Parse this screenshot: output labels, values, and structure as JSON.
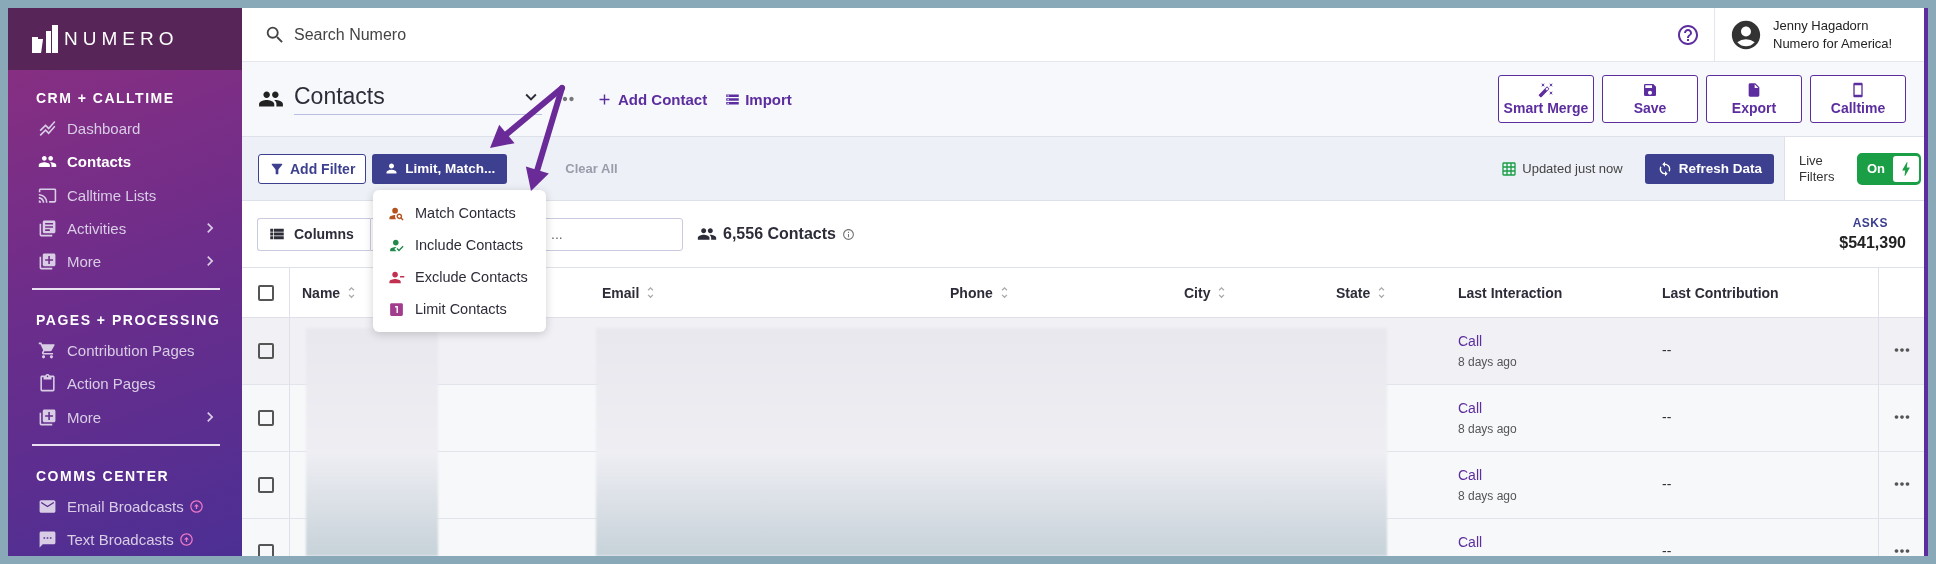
{
  "brand": {
    "name": "NUMERO"
  },
  "sidebar": {
    "sections": [
      {
        "title": "CRM + CALLTIME",
        "items": [
          {
            "label": "Dashboard",
            "selected": false,
            "has_submenu": false,
            "upgrade": false
          },
          {
            "label": "Contacts",
            "selected": true,
            "has_submenu": false,
            "upgrade": false
          },
          {
            "label": "Calltime Lists",
            "selected": false,
            "has_submenu": false,
            "upgrade": false
          },
          {
            "label": "Activities",
            "selected": false,
            "has_submenu": true,
            "upgrade": false
          },
          {
            "label": "More",
            "selected": false,
            "has_submenu": true,
            "upgrade": false
          }
        ]
      },
      {
        "title": "PAGES + PROCESSING",
        "items": [
          {
            "label": "Contribution Pages",
            "selected": false,
            "has_submenu": false,
            "upgrade": false
          },
          {
            "label": "Action Pages",
            "selected": false,
            "has_submenu": false,
            "upgrade": false
          },
          {
            "label": "More",
            "selected": false,
            "has_submenu": true,
            "upgrade": false
          }
        ]
      },
      {
        "title": "COMMS CENTER",
        "items": [
          {
            "label": "Email Broadcasts",
            "selected": false,
            "has_submenu": false,
            "upgrade": true
          },
          {
            "label": "Text Broadcasts",
            "selected": false,
            "has_submenu": false,
            "upgrade": true
          }
        ]
      }
    ]
  },
  "search": {
    "placeholder": "Search Numero"
  },
  "user": {
    "name": "Jenny Hagadorn",
    "org": "Numero for America!"
  },
  "page": {
    "title": "Contacts",
    "add_contact": "Add Contact",
    "import": "Import"
  },
  "header_buttons": [
    "Smart Merge",
    "Save",
    "Export",
    "Calltime"
  ],
  "filter_bar": {
    "add_filter": "Add Filter",
    "limit_match": "Limit, Match...",
    "clear_all": {
      "label": "Clear All",
      "disabled": true
    },
    "updated": "Updated just now",
    "refresh": "Refresh Data",
    "live_filters": {
      "label": "Live Filters",
      "toggle": "On",
      "on": true
    }
  },
  "dropdown_menu": {
    "items": [
      {
        "label": "Match Contacts",
        "color": "#b5501f"
      },
      {
        "label": "Include Contacts",
        "color": "#1f8a4c"
      },
      {
        "label": "Exclude Contacts",
        "color": "#c2304f"
      },
      {
        "label": "Limit Contacts",
        "color": "#a23c8c"
      }
    ]
  },
  "toolbar": {
    "columns": "Columns",
    "search": {
      "placeholder": "..."
    },
    "count": "6,556 Contacts",
    "asks_label": "ASKS",
    "asks_value": "$541,390"
  },
  "table": {
    "header_checked": false,
    "columns": [
      {
        "label": "Name",
        "sortable": true
      },
      {
        "label": "Email",
        "sortable": true
      },
      {
        "label": "Phone",
        "sortable": true
      },
      {
        "label": "City",
        "sortable": true
      },
      {
        "label": "State",
        "sortable": true
      },
      {
        "label": "Last Interaction",
        "sortable": false
      },
      {
        "label": "Last Contribution",
        "sortable": false
      }
    ],
    "rows": [
      {
        "checked": false,
        "last_interaction": "Call",
        "when": "8 days ago",
        "last_contribution": "--"
      },
      {
        "checked": false,
        "last_interaction": "Call",
        "when": "8 days ago",
        "last_contribution": "--"
      },
      {
        "checked": false,
        "last_interaction": "Call",
        "when": "8 days ago",
        "last_contribution": "--"
      },
      {
        "checked": false,
        "last_interaction": "Call",
        "last_contribution": "--"
      }
    ]
  }
}
